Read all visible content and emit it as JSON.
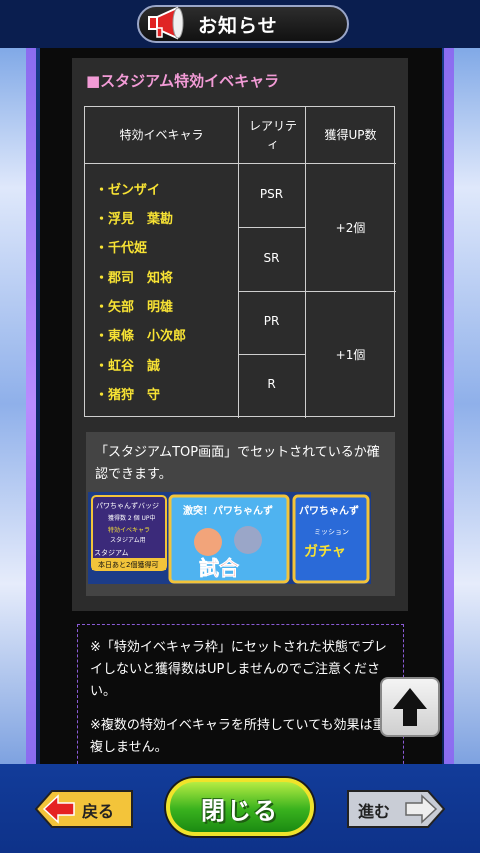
{
  "header": {
    "title": "お知らせ",
    "icon": "megaphone-icon"
  },
  "section": {
    "title": "■スタジアム特効イベキャラ",
    "table": {
      "headers": [
        "特効イベキャラ",
        "レアリティ",
        "獲得UP数"
      ],
      "characters": [
        "・ゼンザイ",
        "・浮見　葉勘",
        "・千代姫",
        "・郡司　知将",
        "・矢部　明雄",
        "・東條　小次郎",
        "・虹谷　誠",
        "・猪狩　守"
      ],
      "rarities": [
        "PSR",
        "SR",
        "PR",
        "R"
      ],
      "up_counts": [
        "+2個",
        "+1個"
      ]
    },
    "note": "「スタジアムTOP画面」でセットされているか確認できます。",
    "banner": {
      "badge_title": "パワちゃんずバッジ",
      "badge_count": "獲得数 2 個 UP中",
      "badge_target": "特効イベキャラ",
      "badge_scope": "スタジアム用",
      "badge_label": "スタジアム",
      "badge_remaining": "本日あと2個獲得可",
      "match_title": "激突！パワちゃんず",
      "match_label": "試合",
      "gacha_title": "パワちゃんず",
      "gacha_sub": "ミッション",
      "gacha_label": "ガチャ"
    }
  },
  "warnings": [
    "※「特効イベキャラ枠」にセットされた状態でプレイしないと獲得数はUPしませんのでご注意ください。",
    "※複数の特効イベキャラを所持していても効果は重複しません。"
  ],
  "footer": {
    "back_label": "戻る",
    "close_label": "閉じる",
    "next_label": "進む"
  },
  "colors": {
    "accent_pink": "#f29bd6",
    "name_yellow": "#f7e234",
    "close_green": "#39b21e"
  }
}
